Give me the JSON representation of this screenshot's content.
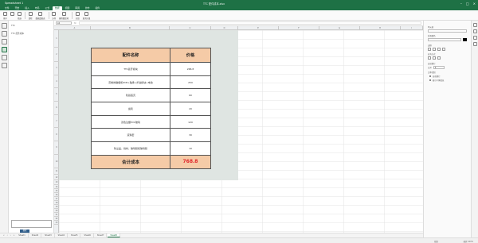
{
  "titlebar": {
    "app": "Spreadsheet 1",
    "document": "TTC 配件成本.xlsx"
  },
  "menu": {
    "tabs": [
      "文件",
      "开始",
      "插入",
      "布局",
      "公式",
      "数据",
      "视图",
      "审阅",
      "协作",
      "插件"
    ],
    "active_index": 5
  },
  "ribbon": {
    "buttons": [
      "排序",
      "",
      "筛选",
      "",
      "清除",
      "数据透视表",
      "分列",
      "删除重复项",
      "分组",
      "取消分组"
    ]
  },
  "left_panel": {
    "items": [
      "TTC",
      "TTC 配件成本"
    ],
    "button": "搜索"
  },
  "formula_bar": {
    "cell_ref": "A1",
    "fx": "fx"
  },
  "grid": {
    "columns": [
      "A",
      "B",
      "C",
      "D",
      "E",
      "F",
      "G",
      "H",
      "I",
      "J"
    ],
    "rows": [
      "1",
      "2",
      "3",
      "4",
      "5",
      "6",
      "7",
      "8",
      "9",
      "10",
      "11",
      "12",
      "13",
      "14",
      "15",
      "16",
      "17",
      "18",
      "19",
      "20",
      "21",
      "22",
      "23"
    ]
  },
  "table": {
    "header": {
      "name": "配件名称",
      "price": "价格"
    },
    "items": [
      {
        "name": "TTC蓝牙模块",
        "price": "268.8"
      },
      {
        "name": "定制热敏相机PCB+轴承+步进模块+电池",
        "price": "250"
      },
      {
        "name": "轮毂底壳",
        "price": "60"
      },
      {
        "name": "齿轮",
        "price": "20"
      },
      {
        "name": "双色注塑PVC玻璃",
        "price": "120"
      },
      {
        "name": "滚珠套",
        "price": "30"
      },
      {
        "name": "防尘盖、线材、玻璃膜和玻璃膜",
        "price": "10"
      }
    ],
    "total": {
      "label": "合计成本",
      "value": "768.8"
    }
  },
  "sheet_tabs": {
    "nav": [
      "«",
      "‹",
      "›",
      "»"
    ],
    "tabs": [
      "Sheet1",
      "Sheet2",
      "Sheet3",
      "Sheet4",
      "Sheet5",
      "Sheet6",
      "Sheet7",
      "Sheet8"
    ],
    "active_index": 7
  },
  "status": {
    "mode": "就绪",
    "zoom": "缩放 100%"
  },
  "right_panel": {
    "section_cell": "单元格",
    "section_bg": "背景颜色",
    "section_border": "边框",
    "section_align": "对齐方式",
    "section_wrap": "自动换行",
    "section_merge": "合并",
    "labels": [
      "文本控制",
      "自动换行",
      "缩小字体填充"
    ],
    "value_wrap": "0"
  },
  "colors": {
    "accent": "#1e7145",
    "header_fill": "#f5cba7",
    "total_red": "#e0262b",
    "grey_area": "#dfe5e2"
  }
}
